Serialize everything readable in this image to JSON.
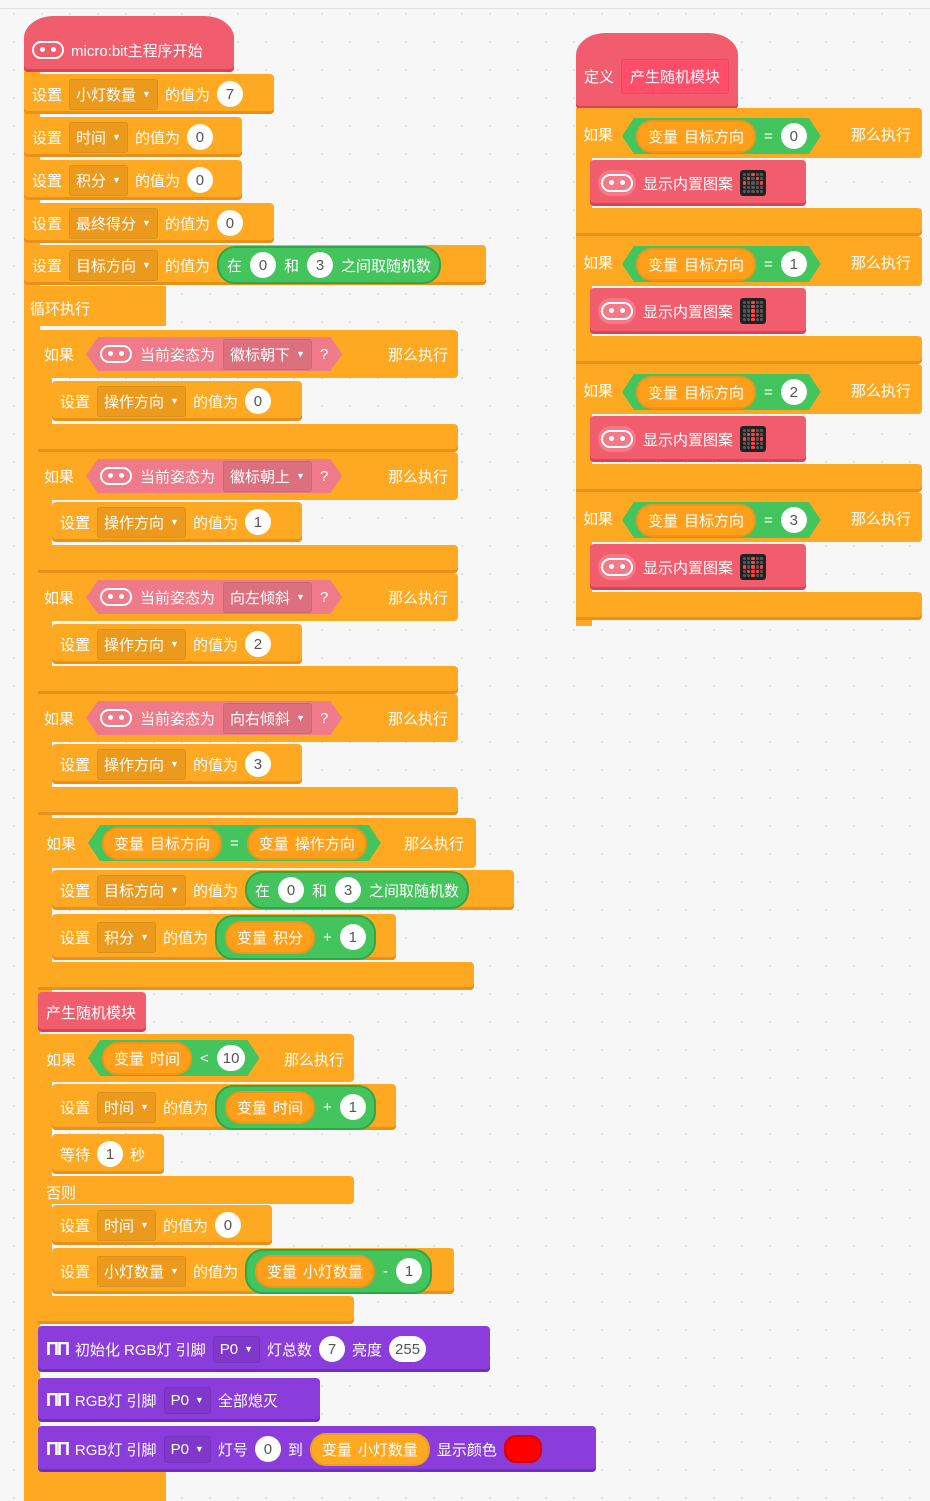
{
  "main": {
    "hat_title": "micro:bit主程序开始",
    "set_kw": "设置",
    "of_value": "的值为",
    "init": [
      {
        "var": "小灯数量",
        "value": "7"
      },
      {
        "var": "时间",
        "value": "0"
      },
      {
        "var": "积分",
        "value": "0"
      },
      {
        "var": "最终得分",
        "value": "0"
      }
    ],
    "random_set": {
      "var": "目标方向",
      "between": "在",
      "low": "0",
      "and": "和",
      "high": "3",
      "tail": "之间取随机数"
    },
    "loop_label": "循环执行",
    "if_kw": "如果",
    "then_kw": "那么执行",
    "gesture_label": "当前姿态为",
    "question": "?",
    "gesture_ifs": [
      {
        "gesture": "徽标朝下",
        "var": "操作方向",
        "value": "0"
      },
      {
        "gesture": "徽标朝上",
        "var": "操作方向",
        "value": "1"
      },
      {
        "gesture": "向左倾斜",
        "var": "操作方向",
        "value": "2"
      },
      {
        "gesture": "向右倾斜",
        "var": "操作方向",
        "value": "3"
      }
    ],
    "match_if": {
      "var_kw": "变量",
      "left": "目标方向",
      "eq": "=",
      "right": "操作方向",
      "set1_var": "目标方向",
      "set2_var": "积分",
      "plus": "+",
      "one": "1"
    },
    "call_label": "产生随机模块",
    "time_if": {
      "var": "时间",
      "lt": "<",
      "limit": "10",
      "wait_kw": "等待",
      "wait_val": "1",
      "sec": "秒",
      "else_kw": "否则",
      "minus": "-"
    },
    "rgb": {
      "init_label": "初始化 RGB灯 引脚",
      "pin": "P0",
      "count_label": "灯总数",
      "count": "7",
      "bright_label": "亮度",
      "bright": "255",
      "rgb_label": "RGB灯 引脚",
      "all_off": "全部熄灭",
      "lamp_label": "灯号",
      "from": "0",
      "to": "到",
      "show_color": "显示颜色",
      "color": "#ff0000"
    }
  },
  "define": {
    "define_kw": "定义",
    "name": "产生随机模块",
    "if_kw": "如果",
    "then_kw": "那么执行",
    "var_kw": "变量",
    "var": "目标方向",
    "eq": "=",
    "show_label": "显示内置图案",
    "cases": [
      "0",
      "1",
      "2",
      "3"
    ]
  }
}
